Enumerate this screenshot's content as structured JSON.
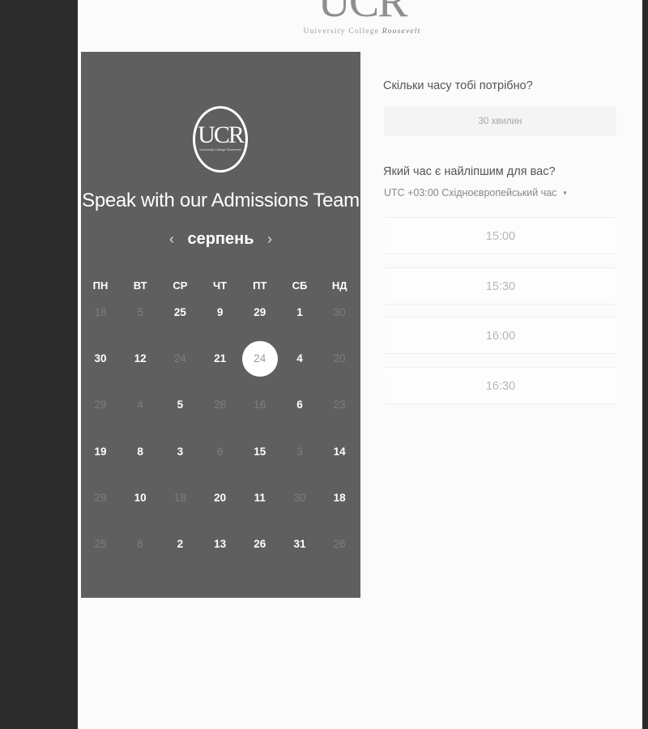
{
  "logo": {
    "mark": "UCR",
    "subtitle_prefix": "University College ",
    "subtitle_name": "Roosevelt"
  },
  "panel": {
    "badge_mark": "UCR",
    "badge_subtitle": "University College Roosevelt",
    "title": "Speak with our Admissions Team",
    "prev_icon": "‹",
    "next_icon": "›",
    "month": "серпень",
    "weekdays": [
      "ПН",
      "ВТ",
      "СР",
      "ЧТ",
      "ПТ",
      "СБ",
      "НД"
    ],
    "weeks": [
      [
        {
          "d": "18",
          "m": true
        },
        {
          "d": "5",
          "m": true
        },
        {
          "d": "25",
          "m": false
        },
        {
          "d": "9",
          "m": false
        },
        {
          "d": "29",
          "m": false
        },
        {
          "d": "1",
          "m": false
        },
        {
          "d": "30",
          "m": true
        }
      ],
      [
        {
          "d": "30",
          "m": false
        },
        {
          "d": "12",
          "m": false
        },
        {
          "d": "24",
          "m": true
        },
        {
          "d": "21",
          "m": false
        },
        {
          "d": "24",
          "m": false,
          "s": true
        },
        {
          "d": "4",
          "m": false
        },
        {
          "d": "20",
          "m": true
        }
      ],
      [
        {
          "d": "29",
          "m": true
        },
        {
          "d": "4",
          "m": true
        },
        {
          "d": "5",
          "m": false
        },
        {
          "d": "28",
          "m": true
        },
        {
          "d": "16",
          "m": true
        },
        {
          "d": "6",
          "m": false
        },
        {
          "d": "23",
          "m": true
        }
      ],
      [
        {
          "d": "19",
          "m": false
        },
        {
          "d": "8",
          "m": false
        },
        {
          "d": "3",
          "m": false
        },
        {
          "d": "6",
          "m": true
        },
        {
          "d": "15",
          "m": false
        },
        {
          "d": "3",
          "m": true
        },
        {
          "d": "14",
          "m": false
        }
      ],
      [
        {
          "d": "29",
          "m": true
        },
        {
          "d": "10",
          "m": false
        },
        {
          "d": "18",
          "m": true
        },
        {
          "d": "20",
          "m": false
        },
        {
          "d": "11",
          "m": false
        },
        {
          "d": "30",
          "m": true
        },
        {
          "d": "18",
          "m": false
        }
      ],
      [
        {
          "d": "25",
          "m": true
        },
        {
          "d": "6",
          "m": true
        },
        {
          "d": "2",
          "m": false
        },
        {
          "d": "13",
          "m": false
        },
        {
          "d": "26",
          "m": false
        },
        {
          "d": "31",
          "m": false
        },
        {
          "d": "26",
          "m": true
        }
      ]
    ]
  },
  "booking": {
    "duration_question": "Скільки часу тобі потрібно?",
    "duration_value": "30 хвилин",
    "time_question": "Який час є найліпшим для вас?",
    "timezone": "UTC +03:00 Східноєвропейський час",
    "timezone_caret": "▼",
    "slots": [
      "15:00",
      "15:30",
      "16:00",
      "16:30"
    ]
  }
}
